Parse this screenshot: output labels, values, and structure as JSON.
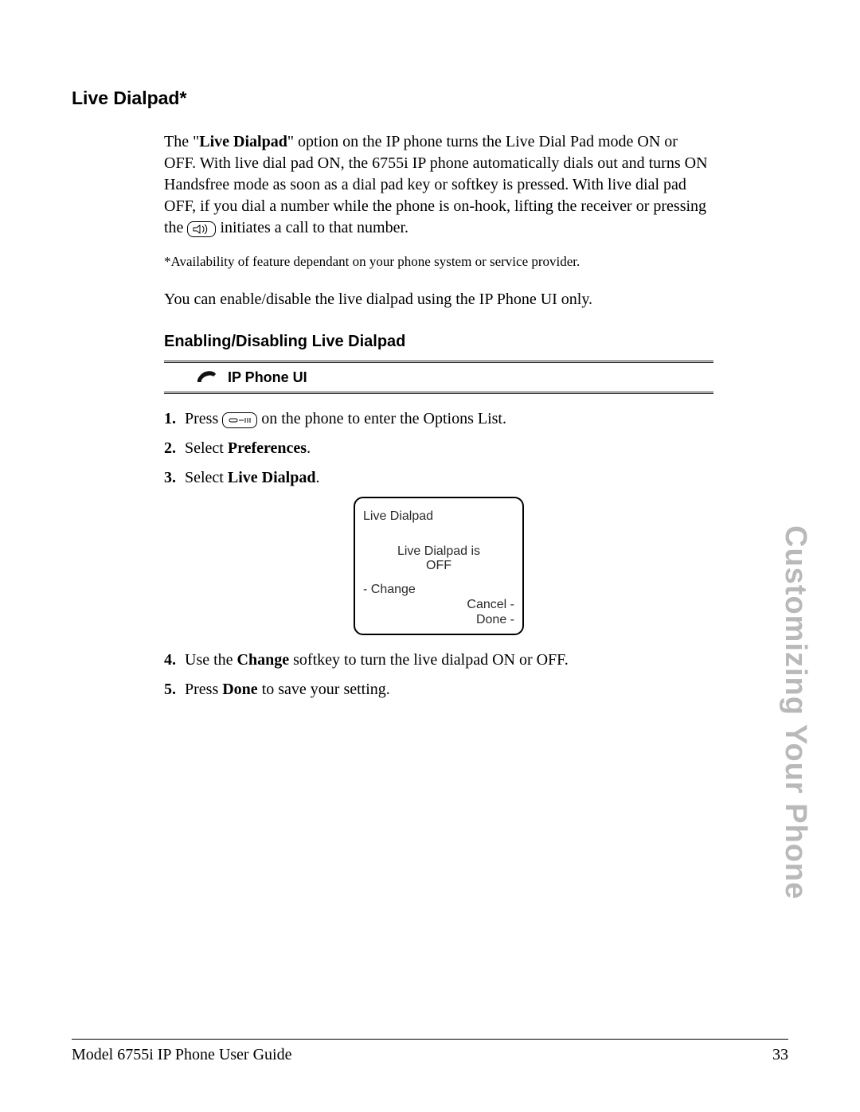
{
  "section_title": "Live Dialpad*",
  "intro": {
    "before_bold": "The \"",
    "bold": "Live Dialpad",
    "after_bold_1": "\" option on the IP phone turns the Live Dial Pad mode ON or OFF. With live dial pad ON, the 6755i IP phone automatically dials out and turns ON Handsfree mode as soon as a dial pad key or softkey is pressed. With live dial pad OFF, if you dial a number while the phone is on-hook, lifting the receiver or pressing the ",
    "after_icon": " initiates a call to that number."
  },
  "availability_note": "*Availability of feature dependant on your phone system or service provider.",
  "enable_note": "You can enable/disable the live dialpad using the IP Phone UI only.",
  "subhead": "Enabling/Disabling Live Dialpad",
  "ui_banner_label": "IP Phone UI",
  "steps": {
    "s1": {
      "num": "1.",
      "before": "Press ",
      "after": " on the phone to enter the Options List."
    },
    "s2": {
      "num": "2.",
      "before": "Select ",
      "bold": "Preferences",
      "after": "."
    },
    "s3": {
      "num": "3.",
      "before": "Select ",
      "bold": "Live Dialpad",
      "after": "."
    },
    "s4": {
      "num": "4.",
      "before": "Use the ",
      "bold": "Change",
      "after": " softkey to turn the live dialpad ON or OFF."
    },
    "s5": {
      "num": "5.",
      "before": "Press ",
      "bold": "Done",
      "after": " to save your setting."
    }
  },
  "phone_screen": {
    "title": "Live Dialpad",
    "status_line1": "Live Dialpad is",
    "status_line2": "OFF",
    "softkey_left": "- Change",
    "softkey_right1": "Cancel -",
    "softkey_right2": "Done -"
  },
  "side_tab": "Customizing Your Phone",
  "footer": {
    "left": "Model 6755i IP Phone User Guide",
    "right": "33"
  }
}
